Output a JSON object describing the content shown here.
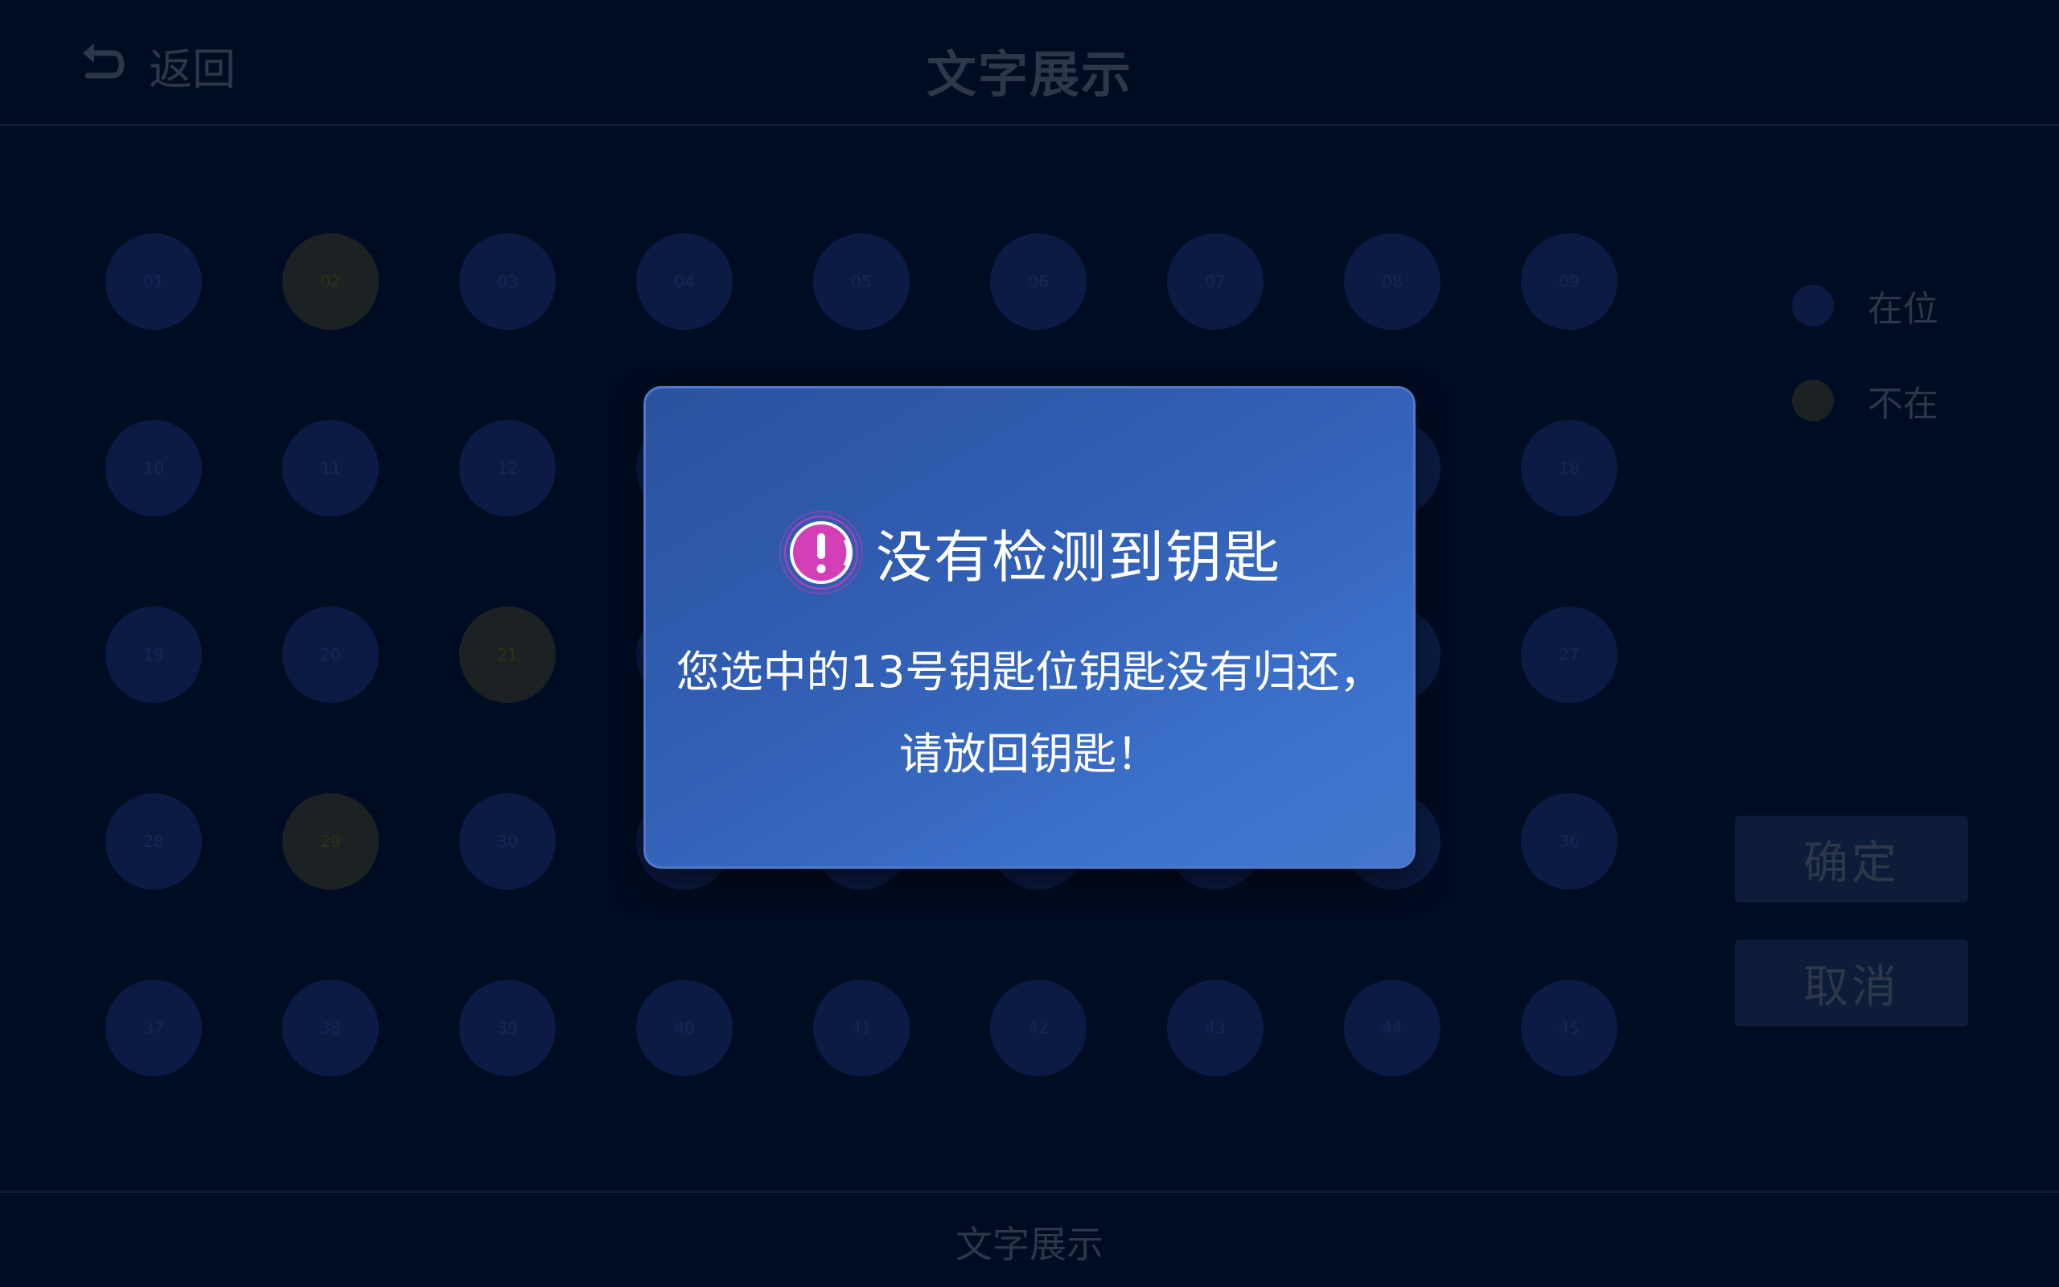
{
  "header": {
    "back_label": "返回",
    "title": "文字展示"
  },
  "slots": [
    {
      "label": "01",
      "status": "present"
    },
    {
      "label": "02",
      "status": "absent"
    },
    {
      "label": "03",
      "status": "present"
    },
    {
      "label": "04",
      "status": "present"
    },
    {
      "label": "05",
      "status": "present"
    },
    {
      "label": "06",
      "status": "present"
    },
    {
      "label": "07",
      "status": "present"
    },
    {
      "label": "08",
      "status": "present"
    },
    {
      "label": "09",
      "status": "present"
    },
    {
      "label": "10",
      "status": "present"
    },
    {
      "label": "11",
      "status": "present"
    },
    {
      "label": "12",
      "status": "present"
    },
    {
      "label": "",
      "status": "present"
    },
    {
      "label": "",
      "status": "present"
    },
    {
      "label": "",
      "status": "present"
    },
    {
      "label": "",
      "status": "present"
    },
    {
      "label": "",
      "status": "present"
    },
    {
      "label": "18",
      "status": "present"
    },
    {
      "label": "19",
      "status": "present"
    },
    {
      "label": "20",
      "status": "present"
    },
    {
      "label": "21",
      "status": "absent"
    },
    {
      "label": "",
      "status": "present"
    },
    {
      "label": "",
      "status": "present"
    },
    {
      "label": "",
      "status": "present"
    },
    {
      "label": "",
      "status": "present"
    },
    {
      "label": "",
      "status": "present"
    },
    {
      "label": "27",
      "status": "present"
    },
    {
      "label": "28",
      "status": "present"
    },
    {
      "label": "29",
      "status": "absent"
    },
    {
      "label": "30",
      "status": "present"
    },
    {
      "label": "",
      "status": "present"
    },
    {
      "label": "",
      "status": "present"
    },
    {
      "label": "",
      "status": "present"
    },
    {
      "label": "",
      "status": "present"
    },
    {
      "label": "",
      "status": "present"
    },
    {
      "label": "36",
      "status": "present"
    },
    {
      "label": "37",
      "status": "present"
    },
    {
      "label": "38",
      "status": "present"
    },
    {
      "label": "39",
      "status": "present"
    },
    {
      "label": "40",
      "status": "present"
    },
    {
      "label": "41",
      "status": "present"
    },
    {
      "label": "42",
      "status": "present"
    },
    {
      "label": "43",
      "status": "present"
    },
    {
      "label": "44",
      "status": "present"
    },
    {
      "label": "45",
      "status": "present"
    }
  ],
  "legend": {
    "present_label": "在位",
    "absent_label": "不在"
  },
  "buttons": {
    "confirm_label": "确定",
    "cancel_label": "取消"
  },
  "footer": {
    "label": "文字展示"
  },
  "dialog": {
    "title": "没有检测到钥匙",
    "message_line1": "您选中的13号钥匙位钥匙没有归还，",
    "message_line2": "请放回钥匙！",
    "icon": "warning-icon"
  },
  "colors": {
    "background": "#000c22",
    "slot_present": "#0b1b44",
    "slot_absent": "#1c2123",
    "dialog_blue": "#3260b5",
    "warning_magenta": "#d43fb8"
  }
}
